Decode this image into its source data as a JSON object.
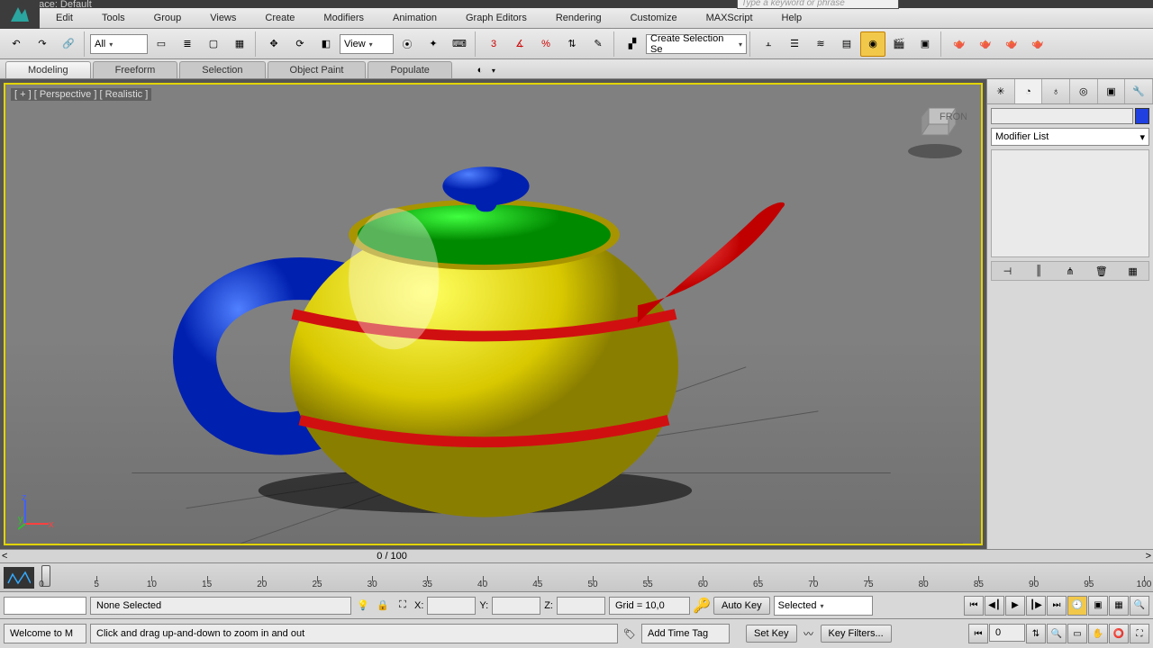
{
  "title": {
    "workspace": "Workspace: Default",
    "search_placeholder": "Type a keyword or phrase"
  },
  "menu": [
    "Edit",
    "Tools",
    "Group",
    "Views",
    "Create",
    "Modifiers",
    "Animation",
    "Graph Editors",
    "Rendering",
    "Customize",
    "MAXScript",
    "Help"
  ],
  "toolbar": {
    "filter": "All",
    "refcoord": "View",
    "selset": "Create Selection Se"
  },
  "ribbon": {
    "tabs": [
      "Modeling",
      "Freeform",
      "Selection",
      "Object Paint",
      "Populate"
    ]
  },
  "viewport": {
    "label": "[ + ] [ Perspective ] [ Realistic ]"
  },
  "panel": {
    "modlist": "Modifier List"
  },
  "track": {
    "frame": "0 / 100",
    "ticks": [
      "0",
      "5",
      "10",
      "15",
      "20",
      "25",
      "30",
      "35",
      "40",
      "45",
      "50",
      "55",
      "60",
      "65",
      "70",
      "75",
      "80",
      "85",
      "90",
      "95",
      "100"
    ]
  },
  "status": {
    "selection": "None Selected",
    "x_lbl": "X:",
    "y_lbl": "Y:",
    "z_lbl": "Z:",
    "grid": "Grid = 10,0",
    "autokey": "Auto Key",
    "setkey": "Set Key",
    "keymode": "Selected",
    "keyfilters": "Key Filters...",
    "welcome": "Welcome to M",
    "hint": "Click and drag up-and-down to zoom in and out",
    "addtag": "Add Time Tag",
    "framenum": "0"
  }
}
